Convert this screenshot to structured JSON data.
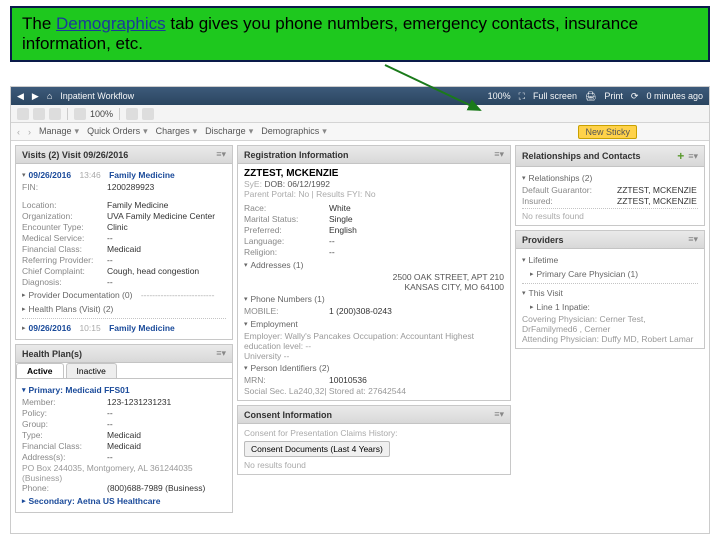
{
  "callout": {
    "pre": "The ",
    "word": "Demographics",
    "post": " tab gives you phone numbers, emergency contacts, insurance information, etc."
  },
  "titlebar": {
    "home_icon": "home-icon",
    "home_label": "Inpatient Workflow",
    "zoom": "100%",
    "full_screen": "Full screen",
    "print": "Print",
    "elapsed": "0 minutes ago"
  },
  "toolbar": {
    "icons": [
      "back",
      "forward",
      "home",
      "doc"
    ],
    "zoom": "100%"
  },
  "secondbar": {
    "items": [
      "Manage",
      "Quick Orders",
      "Charges",
      "Discharge",
      "Demographics"
    ],
    "new_sticky": "New Sticky"
  },
  "left": {
    "visits_head": "Visits (2) Visit 09/26/2016",
    "visit1_date": "09/26/2016",
    "visit1_time": "13:46",
    "visit1_clinic": "Family Medicine",
    "fin_k": "FIN:",
    "fin_v": "1200289923",
    "location_k": "Location:",
    "location_v": "Family Medicine",
    "organization_k": "Organization:",
    "organization_v": "UVA Family Medicine Center",
    "enc_type_k": "Encounter Type:",
    "enc_type_v": "Clinic",
    "med_service_k": "Medical Service:",
    "med_service_v": "--",
    "fin_class_k": "Financial Class:",
    "fin_class_v": "Medicaid",
    "ref_prov_k": "Referring Provider:",
    "ref_prov_v": "--",
    "chief_k": "Chief Complaint:",
    "chief_v": "Cough, head congestion",
    "diagnosis_k": "Diagnosis:",
    "diagnosis_v": "--",
    "prov_doc": "Provider Documentation (0)",
    "health_plan_sub": "Health Plans (Visit) (2)",
    "visit2_date": "09/26/2016",
    "visit2_time": "10:15",
    "visit2_clinic": "Family Medicine",
    "hp_head": "Health Plan(s)",
    "tab_active": "Active",
    "tab_inactive": "Inactive",
    "prim_label": "Primary: Medicaid FFS01",
    "member_k": "Member:",
    "member_v": "123-1231231231",
    "policy_k": "Policy:",
    "policy_v": "--",
    "group_k": "Group:",
    "group_v": "--",
    "type_k": "Type:",
    "type_v": "Medicaid",
    "finclass2_k": "Financial Class:",
    "finclass2_v": "Medicaid",
    "addr_k": "Address(s):",
    "addr_v": "--",
    "addr_line": "PO Box 244035, Montgomery, AL 361244035 (Business)",
    "phone_k": "Phone:",
    "phone_v": "(800)688-7989 (Business)",
    "sec_label": "Secondary: Aetna US Healthcare"
  },
  "mid": {
    "reg_head": "Registration Information",
    "pt_name": "ZZTEST, MCKENZIE",
    "dob_k": "SyE:",
    "dob_line": "DOB: 06/12/1992",
    "parent_portal": "Parent Portal: No | Results FYI: No",
    "race_k": "Race:",
    "race_v": "White",
    "marital_k": "Marital Status:",
    "marital_v": "Single",
    "preferred_k": "Preferred:",
    "preferred_v": "English",
    "language_k": "Language:",
    "language_v": "--",
    "religion_k": "Religion:",
    "religion_v": "--",
    "addresses": "Addresses (1)",
    "address1": "2500 OAK STREET, APT 210",
    "address2": "KANSAS CITY, MO 64100",
    "phones": "Phone Numbers (1)",
    "mobile_k": "MOBILE:",
    "mobile_v": "1 (200)308-0243",
    "employment": "Employment",
    "emp_line": "Employer: Wally's Pancakes Occupation: Accountant Highest education level: --",
    "university": "University --",
    "pi": "Person Identifiers (2)",
    "mrn_k": "MRN:",
    "mrn_v": "10010536",
    "ssn_line": "Social Sec. La240,32| Stored at: 27642544",
    "consent_head": "Consent Information",
    "consent_sub": "Consent for Presentation Claims History:",
    "consent_btn": "Consent Documents (Last 4 Years)",
    "no_results": "No results found"
  },
  "right": {
    "rel_head": "Relationships and Contacts",
    "rel_sub": "Relationships (2)",
    "rel1_k": "Default Guarantor:",
    "rel1_v": "ZZTEST, MCKENZIE",
    "rel2_k": "Insured:",
    "rel2_v": "ZZTEST, MCKENZIE",
    "no_results": "No results found",
    "prov_head": "Providers",
    "lifetime": "Lifetime",
    "pcp": "Primary Care Physician (1)",
    "this_visit": "This Visit",
    "lifetime2": "Line 1 Inpatie:",
    "covering": "Covering Physician: Cerner Test, DrFamilymed6 , Cerner",
    "attending": "Attending Physician: Duffy MD, Robert Lamar"
  }
}
